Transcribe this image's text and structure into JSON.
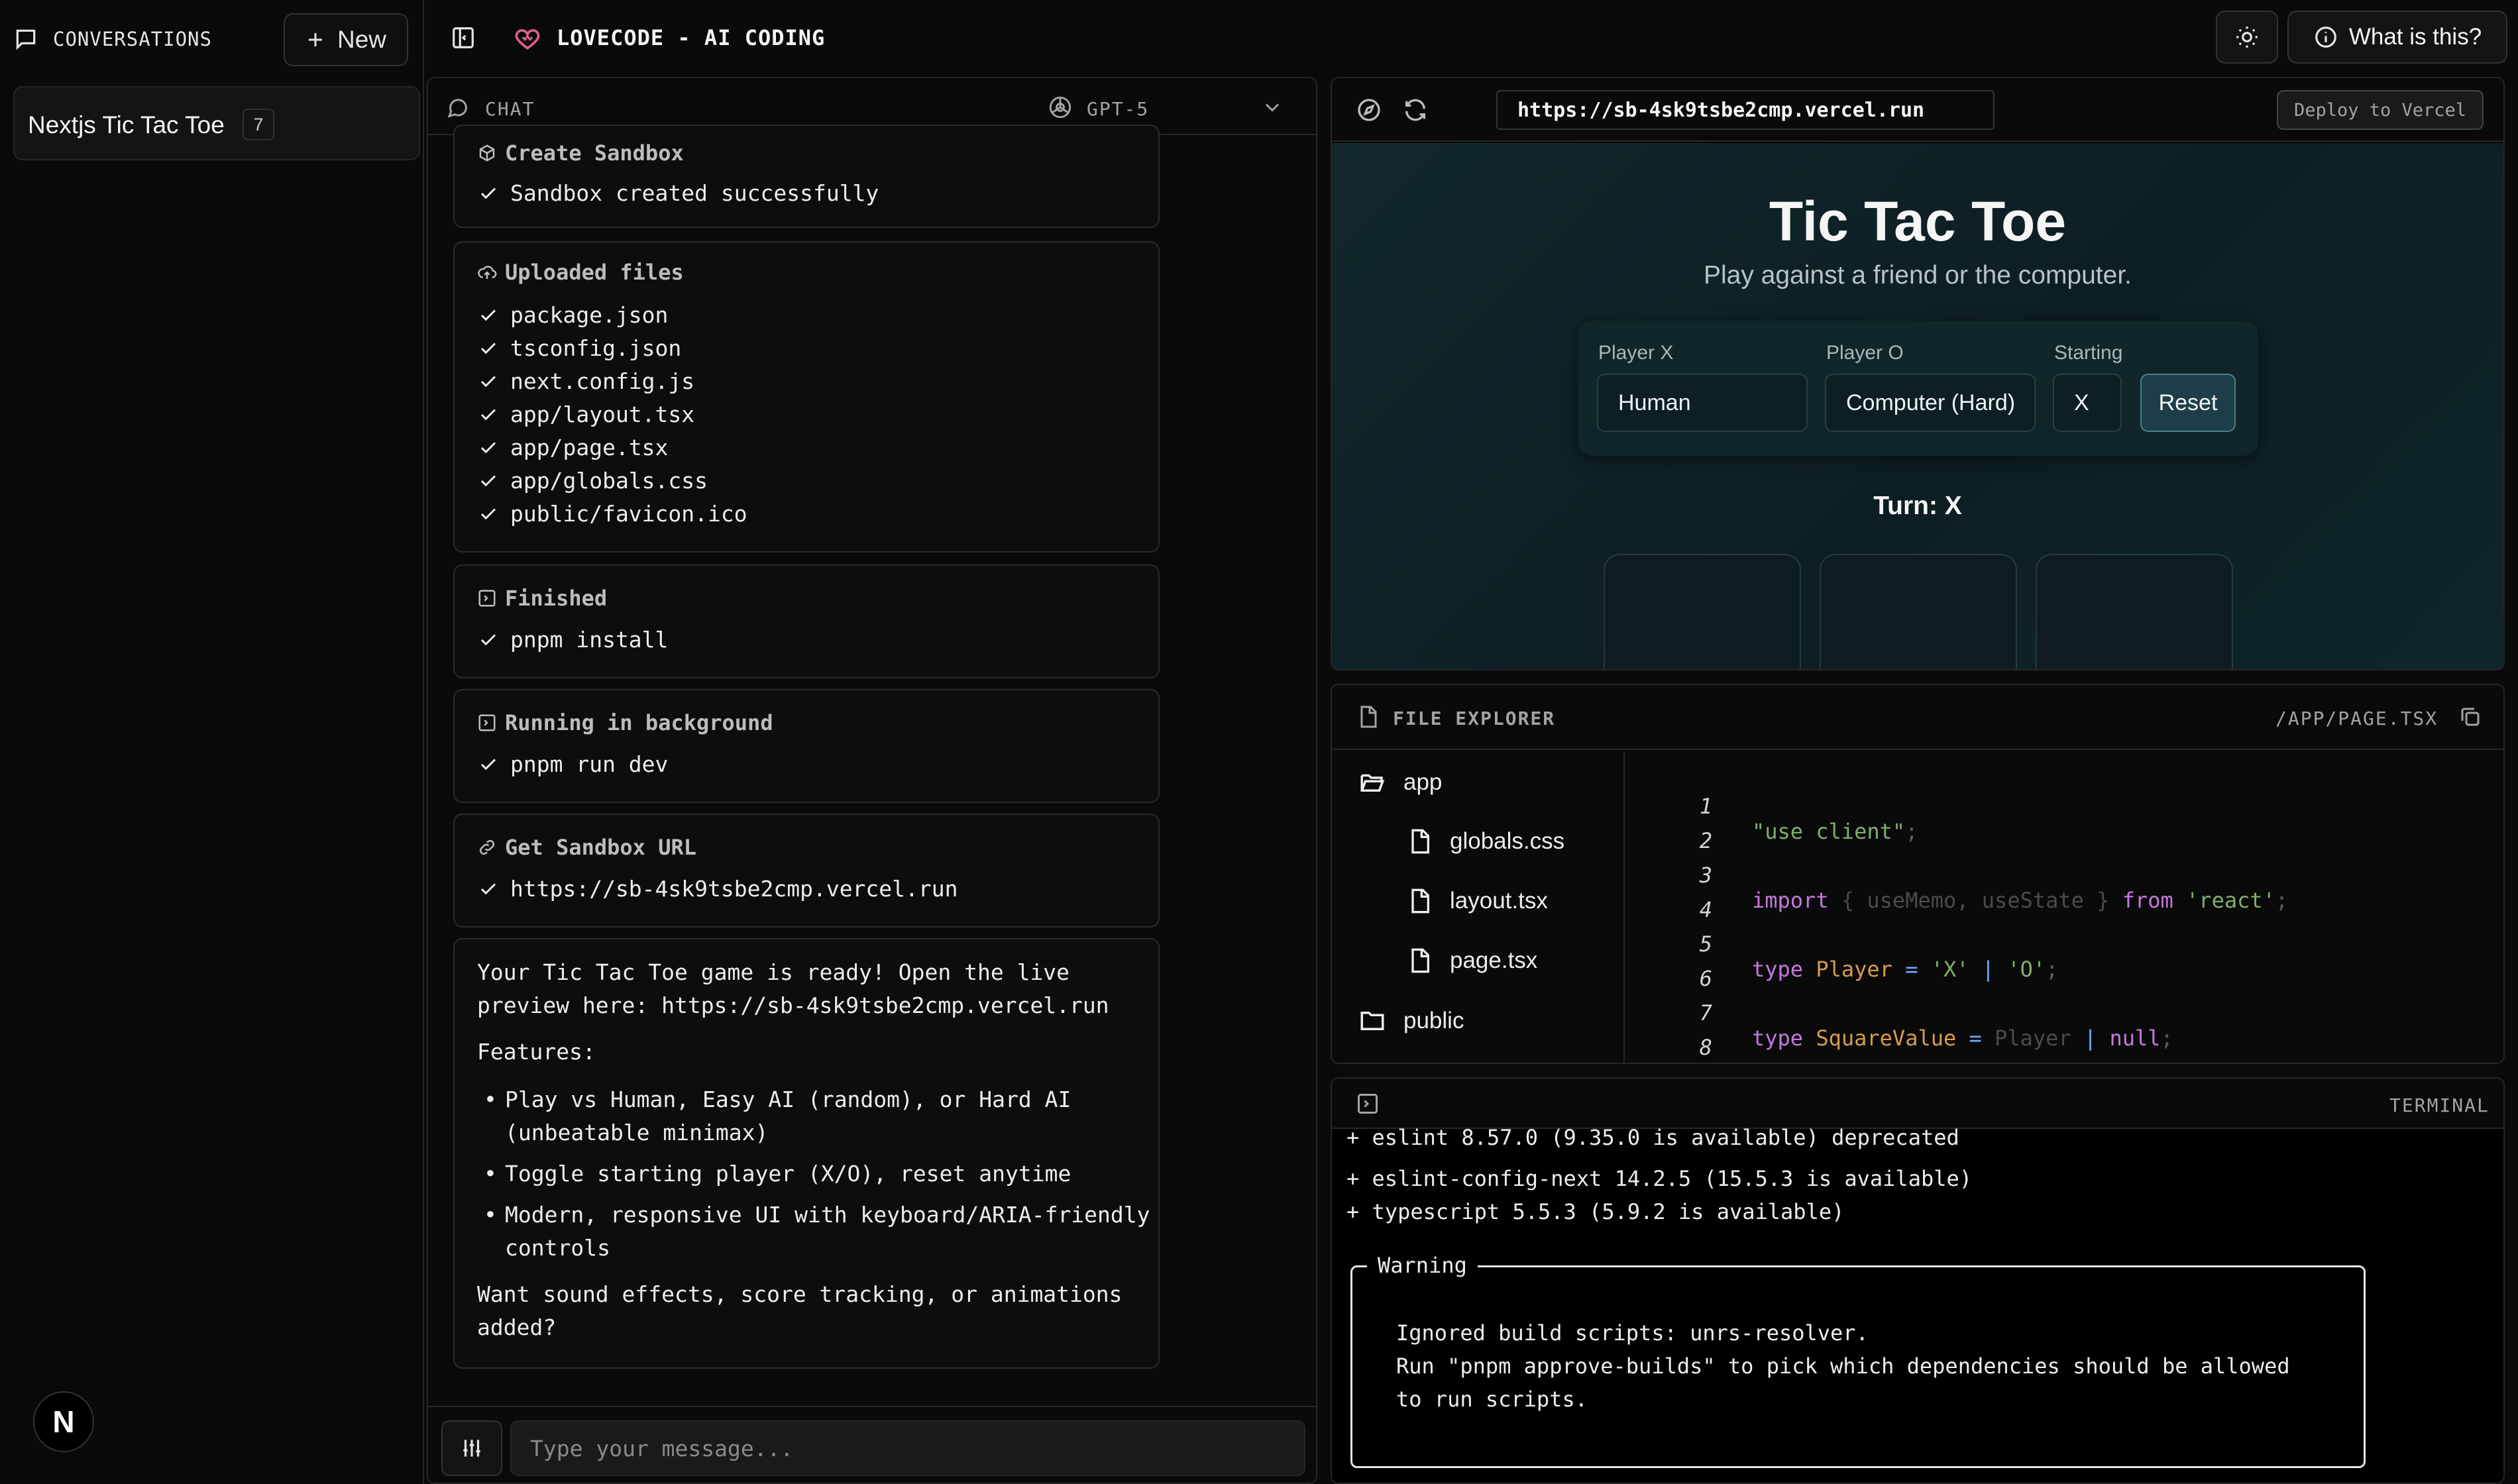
{
  "sidebar": {
    "title": "CONVERSATIONS",
    "new_label": "New",
    "conversation": {
      "title": "Nextjs Tic Tac Toe",
      "count": "7"
    },
    "logo_letter": "N"
  },
  "topbar": {
    "brand": "LOVECODE - AI CODING",
    "what_label": "What is this?"
  },
  "chat": {
    "header_label": "CHAT",
    "model": "GPT-5",
    "cards": {
      "sandbox": {
        "title": "Create Sandbox",
        "line": "Sandbox created successfully"
      },
      "uploaded": {
        "title": "Uploaded files",
        "files": [
          "package.json",
          "tsconfig.json",
          "next.config.js",
          "app/layout.tsx",
          "app/page.tsx",
          "app/globals.css",
          "public/favicon.ico"
        ]
      },
      "finished": {
        "title": "Finished",
        "line": "pnpm install"
      },
      "running": {
        "title": "Running in background",
        "line": "pnpm run dev"
      },
      "url": {
        "title": "Get Sandbox URL",
        "line": "https://sb-4sk9tsbe2cmp.vercel.run"
      }
    },
    "message": {
      "intro1": "Your Tic Tac Toe game is ready! Open the live",
      "intro2": "preview here: https://sb-4sk9tsbe2cmp.vercel.run",
      "features_label": "Features:",
      "bullets": [
        [
          "Play vs Human, Easy AI (random), or Hard AI",
          "(unbeatable minimax)"
        ],
        [
          "Toggle starting player (X/O), reset anytime"
        ],
        [
          "Modern, responsive UI with keyboard/ARIA-friendly",
          "controls"
        ]
      ],
      "outro1": "Want sound effects, score tracking, or animations",
      "outro2": "added?"
    },
    "input_placeholder": "Type your message..."
  },
  "preview": {
    "url": "https://sb-4sk9tsbe2cmp.vercel.run",
    "deploy_label": "Deploy to Vercel",
    "game": {
      "title": "Tic Tac Toe",
      "subtitle": "Play against a friend or the computer.",
      "player_x_label": "Player X",
      "player_x_value": "Human",
      "player_o_label": "Player O",
      "player_o_value": "Computer (Hard)",
      "starting_label": "Starting",
      "starting_value": "X",
      "reset_label": "Reset",
      "turn": "Turn: X"
    }
  },
  "file_explorer": {
    "label": "FILE EXPLORER",
    "path": "/APP/PAGE.TSX",
    "tree": {
      "app": "app",
      "globals": "globals.css",
      "layout": "layout.tsx",
      "page": "page.tsx",
      "public": "public"
    },
    "code": {
      "n1": "1",
      "n2": "2",
      "n3": "3",
      "n4": "4",
      "n5": "5",
      "n6": "6",
      "n7": "7",
      "n8": "8",
      "l1": "\"use client\"",
      "l3_import": "import",
      "l3_names": " { useMemo, useState } ",
      "l3_from": "from",
      "l3_mod": " 'react'",
      "l5_type": "type",
      "l5_name": " Player",
      "l5_eq": " = ",
      "l5_x": "'X'",
      "l5_bar": " | ",
      "l5_o": "'O'",
      "l7_type": "type",
      "l7_name": " SquareValue",
      "l7_eq": " = ",
      "l7_player": "Player",
      "l7_bar": " | ",
      "l7_null": "null"
    }
  },
  "terminal": {
    "label": "TERMINAL",
    "lines": [
      "+ eslint 8.57.0 (9.35.0 is available) deprecated",
      "+ eslint-config-next 14.2.5 (15.5.3 is available)",
      "+ typescript 5.5.3 (5.9.2 is available)"
    ],
    "warning_title": "Warning",
    "warning_lines": [
      "Ignored build scripts: unrs-resolver.",
      "Run \"pnpm approve-builds\" to pick which dependencies should be allowed",
      "to run scripts."
    ]
  }
}
